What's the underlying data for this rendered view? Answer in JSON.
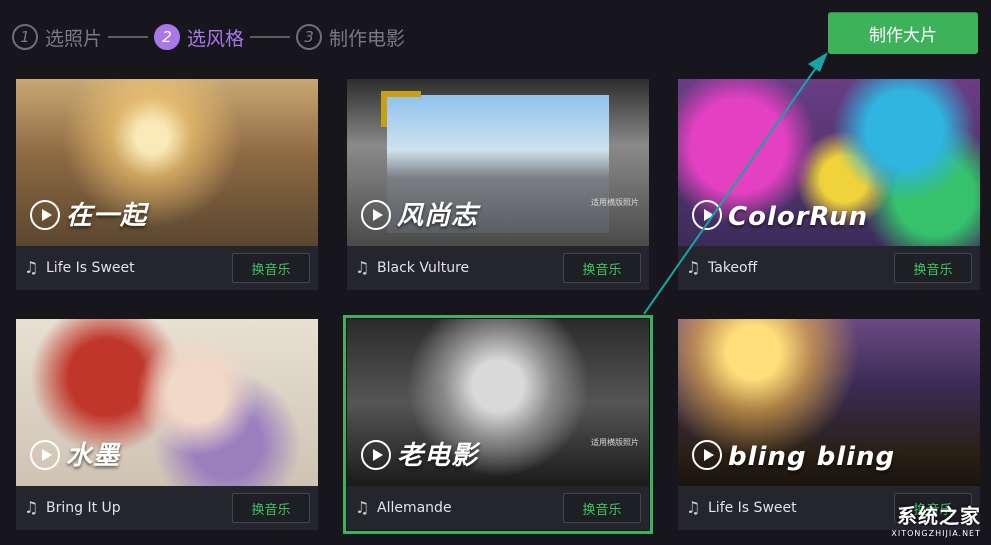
{
  "steps": [
    {
      "num": "1",
      "label": "选照片"
    },
    {
      "num": "2",
      "label": "选风格"
    },
    {
      "num": "3",
      "label": "制作电影"
    }
  ],
  "make_button": "制作大片",
  "change_music_label": "换音乐",
  "watermark_text": "适用横版照片",
  "cards": [
    {
      "title": "在一起",
      "song": "Life Is Sweet"
    },
    {
      "title": "风尚志",
      "song": "Black Vulture"
    },
    {
      "title": "ColorRun",
      "song": "Takeoff"
    },
    {
      "title": "水墨",
      "song": "Bring It Up"
    },
    {
      "title": "老电影",
      "song": "Allemande"
    },
    {
      "title": "bling bling",
      "song": "Life Is Sweet"
    }
  ],
  "site_logo": {
    "cn": "系统之家",
    "en": "XITONGZHIJIA.NET"
  },
  "colors": {
    "accent_green": "#3db25b",
    "active_step": "#a877e8",
    "annotation_arrow": "#1aa3a3"
  }
}
